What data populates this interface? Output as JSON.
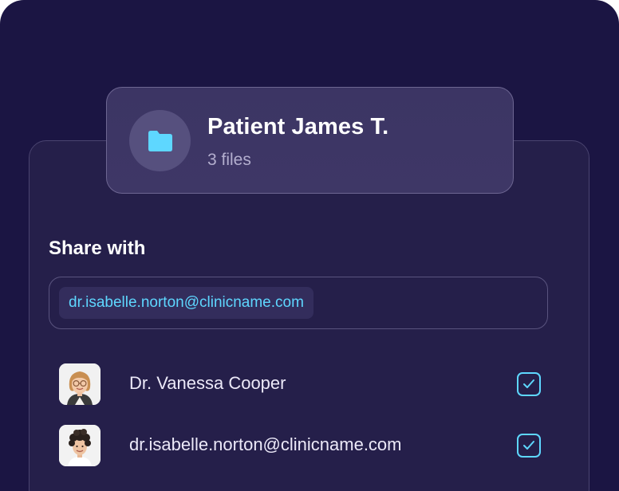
{
  "colors": {
    "background": "#1b1543",
    "panel": "#251f4a",
    "accent": "#5ed7ff",
    "card": "#3c3564"
  },
  "file": {
    "icon": "folder-icon",
    "title": "Patient James T.",
    "count": "3 files"
  },
  "share": {
    "label": "Share with",
    "chip_email": "dr.isabelle.norton@clinicname.com"
  },
  "recipients": [
    {
      "name": "Dr. Vanessa Cooper",
      "avatar": "avatar-photo",
      "checked": true,
      "check_icon": "checkmark-icon"
    },
    {
      "name": "dr.isabelle.norton@clinicname.com",
      "avatar": "avatar-photo",
      "checked": true,
      "check_icon": "checkmark-icon"
    }
  ]
}
